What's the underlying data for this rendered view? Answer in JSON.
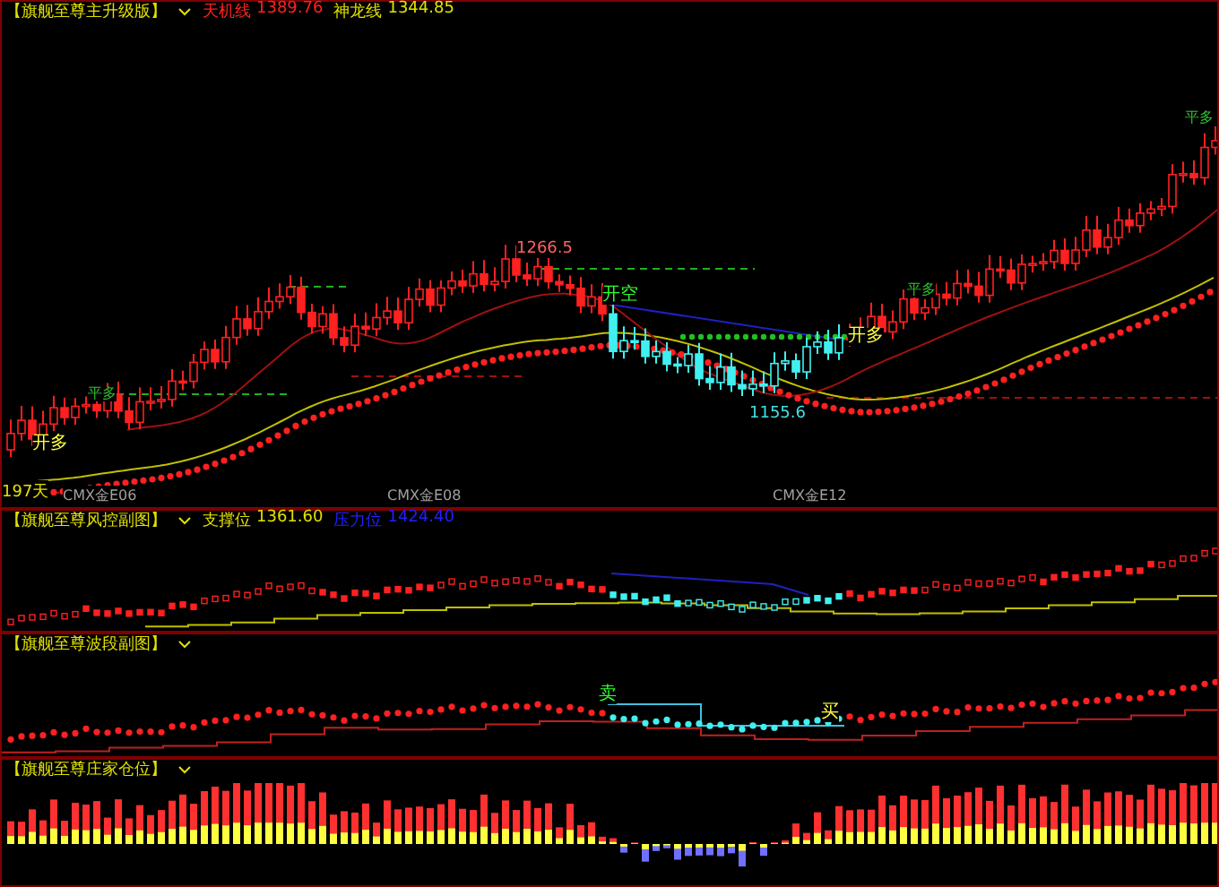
{
  "main_panel": {
    "title": "【旗舰至尊主升级版】",
    "indicators": [
      {
        "label": "天机线",
        "value": "1389.76",
        "color": "#ff2020"
      },
      {
        "label": "神龙线",
        "value": "1344.85",
        "color": "#e0e000"
      }
    ],
    "annotations": [
      {
        "text": "开多",
        "kind": "buy"
      },
      {
        "text": "平多",
        "kind": "close"
      },
      {
        "text": "1266.5",
        "kind": "high"
      },
      {
        "text": "开空",
        "kind": "sell"
      },
      {
        "text": "1155.6",
        "kind": "low"
      },
      {
        "text": "开多",
        "kind": "buy"
      },
      {
        "text": "平多",
        "kind": "close"
      },
      {
        "text": "平多",
        "kind": "close"
      }
    ],
    "days_label": "197天",
    "axis_labels": [
      "CMX金E06",
      "CMX金E08",
      "CMX金E12"
    ]
  },
  "risk_panel": {
    "title": "【旗舰至尊风控副图】",
    "indicators": [
      {
        "label": "支撑位",
        "value": "1361.60",
        "color": "#e0e000"
      },
      {
        "label": "压力位",
        "value": "1424.40",
        "color": "#2020ff"
      }
    ]
  },
  "swing_panel": {
    "title": "【旗舰至尊波段副图】",
    "annotations": [
      {
        "text": "卖",
        "kind": "sell"
      },
      {
        "text": "买",
        "kind": "buy"
      }
    ]
  },
  "position_panel": {
    "title": "【旗舰至尊庄家仓位】"
  }
}
